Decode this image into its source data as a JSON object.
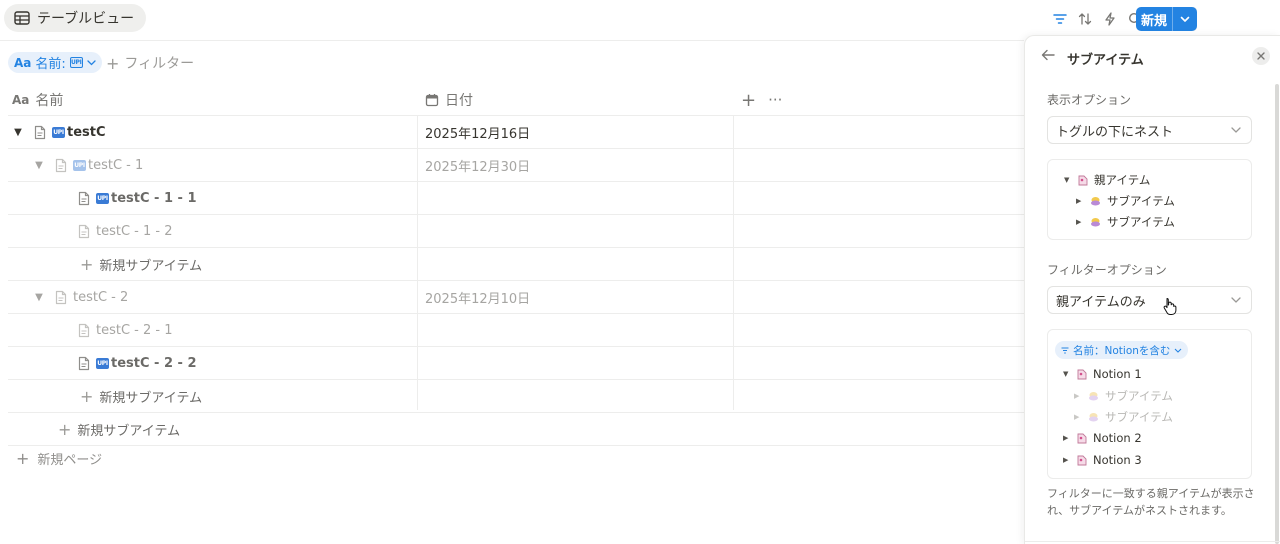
{
  "view": {
    "tab_label": "テーブルビュー",
    "icon": "table-icon"
  },
  "toolbar": {
    "icons": [
      "filter-icon",
      "sort-icon",
      "automation-bolt-icon",
      "search-icon",
      "expand-icon",
      "settings-sliders-icon"
    ],
    "new_label": "新規"
  },
  "filter_bar": {
    "chip_prefix": "Aa",
    "chip_label": "名前:",
    "add_filter_label": "フィルター"
  },
  "table": {
    "columns": [
      {
        "icon": "Aa",
        "label": "名前"
      },
      {
        "icon": "calendar-icon",
        "label": "日付"
      }
    ],
    "rows": [
      {
        "title": "testC",
        "date": "2025年12月16日",
        "level": 0,
        "toggle": "▼",
        "badge": true,
        "state": "normal"
      },
      {
        "title": "testC - 1",
        "date": "2025年12月30日",
        "level": 1,
        "toggle": "▼",
        "badge": true,
        "state": "dim"
      },
      {
        "title": "testC - 1 - 1",
        "date": "",
        "level": 2,
        "toggle": "",
        "badge": true,
        "state": "dim2"
      },
      {
        "title": "testC - 1 - 2",
        "date": "",
        "level": 2,
        "toggle": "",
        "badge": false,
        "state": "dim"
      },
      {
        "title": "新規サブアイテム",
        "date": "",
        "level": 2,
        "type": "new-sub"
      },
      {
        "title": "testC - 2",
        "date": "2025年12月10日",
        "level": 1,
        "toggle": "▼",
        "badge": false,
        "state": "dim"
      },
      {
        "title": "testC - 2 - 1",
        "date": "",
        "level": 2,
        "toggle": "",
        "badge": false,
        "state": "dim"
      },
      {
        "title": "testC - 2 - 2",
        "date": "",
        "level": 2,
        "toggle": "",
        "badge": true,
        "state": "dim2"
      },
      {
        "title": "新規サブアイテム",
        "date": "",
        "level": 2,
        "type": "new-sub"
      },
      {
        "title": "新規サブアイテム",
        "date": "",
        "level": 1,
        "type": "new-sub"
      }
    ],
    "new_page_label": "新規ページ"
  },
  "panel": {
    "title": "サブアイテム",
    "display_options_label": "表示オプション",
    "display_select_value": "トグルの下にネスト",
    "display_preview": [
      {
        "label": "親アイテム",
        "level": 0,
        "icon": "parent-page-icon"
      },
      {
        "label": "サブアイテム",
        "level": 1,
        "icon": "sub-page-icon"
      },
      {
        "label": "サブアイテム",
        "level": 1,
        "icon": "sub-page-icon"
      }
    ],
    "filter_options_label": "フィルターオプション",
    "filter_select_value": "親アイテムのみ",
    "filter_preview_chip": "名前：Notionを含む",
    "filter_preview": [
      {
        "label": "Notion 1",
        "level": 0,
        "faded": false
      },
      {
        "label": "サブアイテム",
        "level": 1,
        "faded": true
      },
      {
        "label": "サブアイテム",
        "level": 1,
        "faded": true
      },
      {
        "label": "Notion 2",
        "level": 0,
        "faded": false
      },
      {
        "label": "Notion 3",
        "level": 0,
        "faded": false
      }
    ],
    "note": "フィルターに一致する親アイテムが表示され、サブアイテムがネストされます。"
  },
  "colors": {
    "accent": "#2383e2",
    "text": "#37352f",
    "muted": "#787774",
    "chip_bg": "#e7f0fb"
  }
}
